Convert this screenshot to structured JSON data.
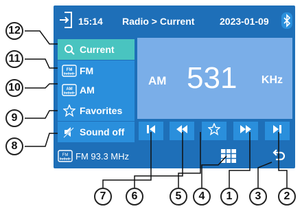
{
  "status": {
    "time": "15:14",
    "breadcrumb": "Radio > Current",
    "date": "2023-01-09"
  },
  "sidebar": {
    "items": [
      {
        "label": "Current",
        "icon": "search-icon",
        "active": true
      },
      {
        "label": "FM",
        "icon": "fm-radio-icon",
        "icon_text": "FM"
      },
      {
        "label": "AM",
        "icon": "am-radio-icon",
        "icon_text": "AM"
      },
      {
        "label": "Favorites",
        "icon": "star-icon"
      },
      {
        "label": "Sound off",
        "icon": "mute-icon"
      }
    ]
  },
  "display": {
    "band": "AM",
    "frequency": "531",
    "unit": "KHz"
  },
  "controls": [
    {
      "name": "previous-station-button",
      "icon": "skip-previous-icon"
    },
    {
      "name": "seek-backward-button",
      "icon": "rewind-icon"
    },
    {
      "name": "add-favorite-button",
      "icon": "star-icon"
    },
    {
      "name": "seek-forward-button",
      "icon": "fast-forward-icon"
    },
    {
      "name": "next-station-button",
      "icon": "skip-next-icon"
    }
  ],
  "bottom": {
    "info": "FM 93.3 MHz",
    "icon_text": "FM"
  },
  "callouts": [
    "12",
    "11",
    "10",
    "9",
    "8",
    "7",
    "6",
    "5",
    "4",
    "1",
    "3",
    "2"
  ],
  "colors": {
    "background": "#1e6fb8",
    "button": "#2a8fdc",
    "active": "#49c4c0",
    "display": "#7aaee8"
  }
}
